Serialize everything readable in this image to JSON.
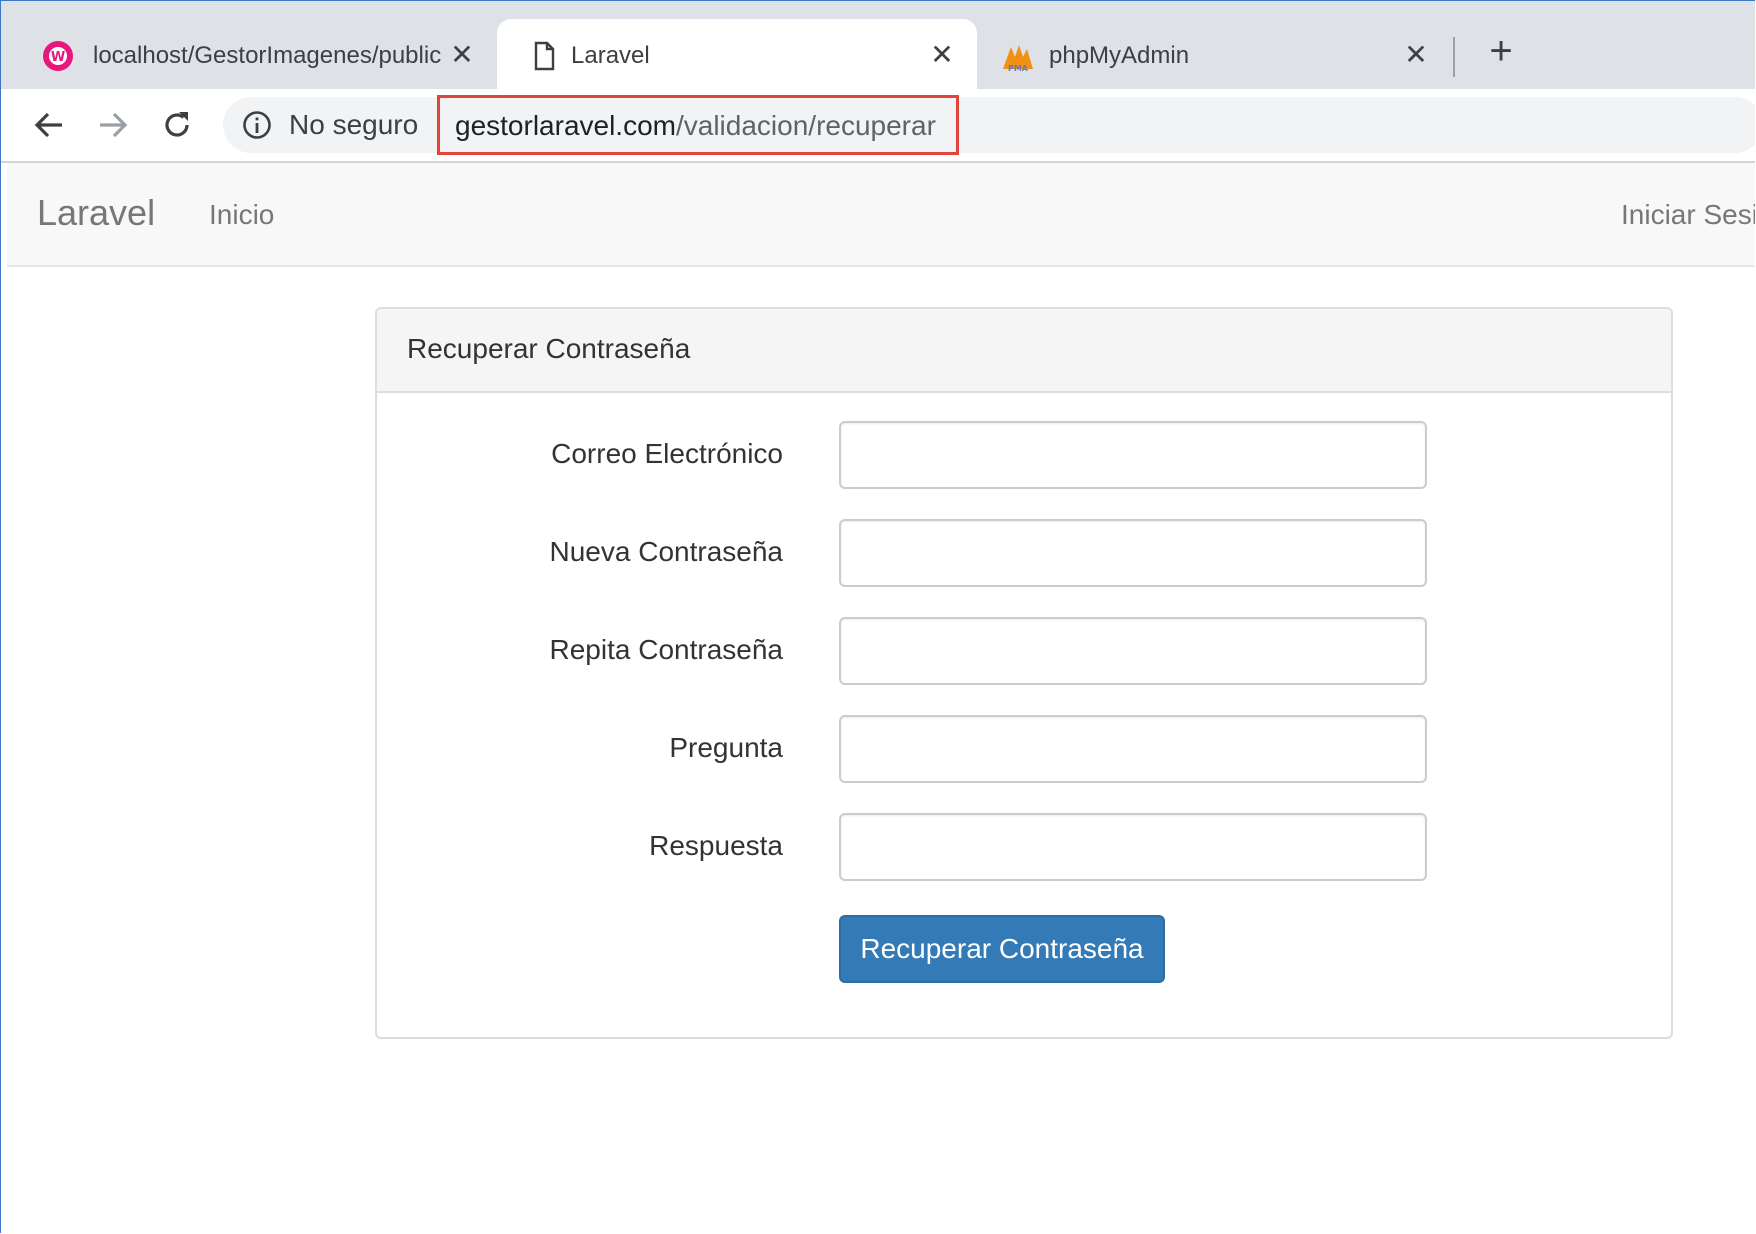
{
  "browser": {
    "tabs": [
      {
        "title": "localhost/GestorImagenes/public",
        "icon": "wampserver-icon",
        "active": false
      },
      {
        "title": "Laravel",
        "icon": "document-icon",
        "active": true
      },
      {
        "title": "phpMyAdmin",
        "icon": "phpmyadmin-icon",
        "active": false
      }
    ],
    "new_tab_symbol": "+",
    "close_symbol": "✕",
    "security_label": "No seguro",
    "url_domain": "gestorlaravel.com",
    "url_path": "/validacion/recuperar"
  },
  "navbar": {
    "brand": "Laravel",
    "home_link": "Inicio",
    "login_link": "Iniciar Sesi"
  },
  "panel": {
    "title": "Recuperar Contraseña",
    "fields": [
      {
        "label": "Correo Electrónico",
        "value": ""
      },
      {
        "label": "Nueva Contraseña",
        "value": ""
      },
      {
        "label": "Repita Contraseña",
        "value": ""
      },
      {
        "label": "Pregunta",
        "value": ""
      },
      {
        "label": "Respuesta",
        "value": ""
      }
    ],
    "submit_label": "Recuperar Contraseña"
  },
  "colors": {
    "primary_button": "#337ab7",
    "highlight_box": "#e0443a",
    "tabstrip": "#dee1e6"
  }
}
